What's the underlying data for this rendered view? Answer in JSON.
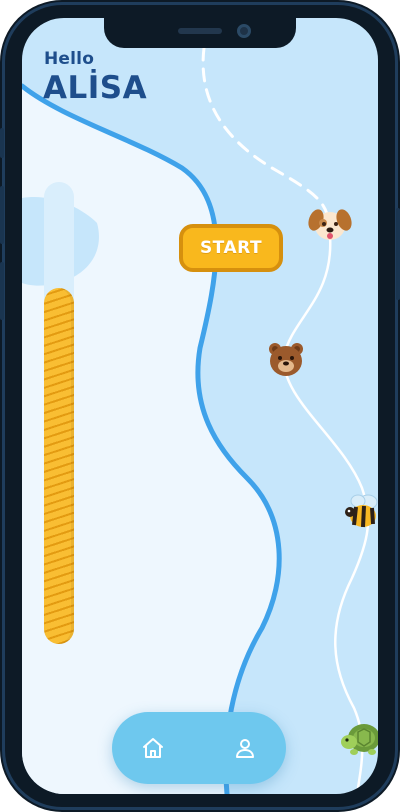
{
  "header": {
    "greeting": "Hello",
    "username": "ALİSA"
  },
  "progress": {
    "level": 0.77,
    "fill_color": "#f7b327",
    "track_color": "#d9eefc"
  },
  "actions": {
    "start_label": "START",
    "start_color": "#f9b81d"
  },
  "path": {
    "nodes": [
      "puppy-icon",
      "bear-icon",
      "bee-icon",
      "turtle-icon"
    ]
  },
  "nav": {
    "items": [
      "home-icon",
      "user-profile-icon"
    ],
    "pill_color": "#6ec8ee"
  },
  "colors": {
    "background": "#c6e6fb",
    "light_region": "#eef7fe",
    "wave_line": "#3fa2ea",
    "title": "#1e4e8c"
  }
}
